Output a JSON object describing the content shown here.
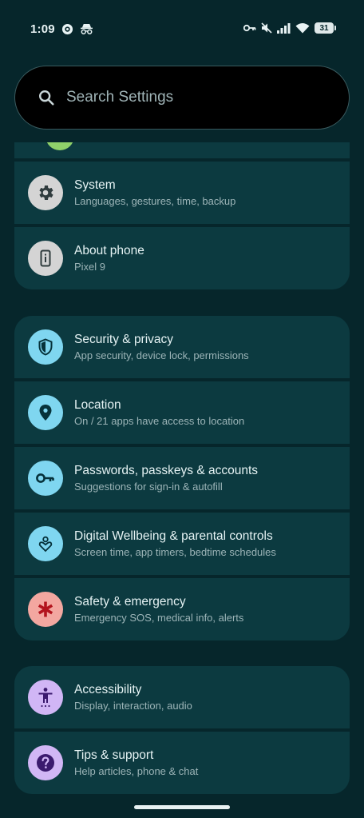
{
  "status_bar": {
    "time": "1:09",
    "battery": "31",
    "icons": [
      "circle-dot-icon",
      "incognito-icon",
      "vpn-key-icon",
      "mute-icon",
      "signal-icon",
      "wifi-icon",
      "battery-icon"
    ]
  },
  "search": {
    "placeholder": "Search Settings"
  },
  "groups": [
    {
      "items": [
        {
          "title": "System",
          "subtitle": "Languages, gestures, time, backup",
          "icon": "gear-icon",
          "color": "#d4d4d4"
        },
        {
          "title": "About phone",
          "subtitle": "Pixel 9",
          "icon": "phone-info-icon",
          "color": "#d4d4d4"
        }
      ]
    },
    {
      "items": [
        {
          "title": "Security & privacy",
          "subtitle": "App security, device lock, permissions",
          "icon": "shield-icon",
          "color": "#7fd6f0"
        },
        {
          "title": "Location",
          "subtitle": "On / 21 apps have access to location",
          "icon": "location-pin-icon",
          "color": "#7fd6f0"
        },
        {
          "title": "Passwords, passkeys & accounts",
          "subtitle": "Suggestions for sign-in & autofill",
          "icon": "key-icon",
          "color": "#7fd6f0"
        },
        {
          "title": "Digital Wellbeing & parental controls",
          "subtitle": "Screen time, app timers, bedtime schedules",
          "icon": "wellbeing-icon",
          "color": "#7fd6f0"
        },
        {
          "title": "Safety & emergency",
          "subtitle": "Emergency SOS, medical info, alerts",
          "icon": "asterisk-icon",
          "color": "#f3a7a0"
        }
      ]
    },
    {
      "items": [
        {
          "title": "Accessibility",
          "subtitle": "Display, interaction, audio",
          "icon": "accessibility-icon",
          "color": "#d1b6f5"
        },
        {
          "title": "Tips & support",
          "subtitle": "Help articles, phone & chat",
          "icon": "help-icon",
          "color": "#d1b6f5"
        }
      ]
    }
  ],
  "colors": {
    "background": "#06262b",
    "card": "#0c3a40",
    "accent_cyan": "#7fd6f0",
    "accent_red": "#f3a7a0",
    "accent_purple": "#d1b6f5"
  }
}
